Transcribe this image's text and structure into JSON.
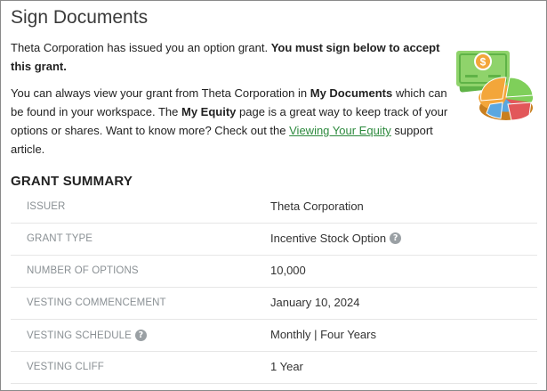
{
  "page": {
    "title": "Sign Documents"
  },
  "intro": {
    "p1_text": "Theta Corporation has issued you an option grant. ",
    "p1_bold": "You must sign below to accept this grant.",
    "p2_a": "You can always view your grant from Theta Corporation in ",
    "p2_b_bold": "My Documents",
    "p2_c": " which can be found in your workspace. The ",
    "p2_d_bold": "My Equity",
    "p2_e": " page is a great way to keep track of your options or shares. Want to know more? Check out the ",
    "p2_link": "Viewing Your Equity",
    "p2_f": " support article."
  },
  "illustration": {
    "icon": "money-and-pie-chart-icon",
    "currency_symbol": "$",
    "colors": {
      "bill": "#8fd36b",
      "bill_dark": "#5fb347",
      "pie_orange": "#f3a63a",
      "pie_blue": "#5aa7e0",
      "pie_green": "#7fcf5a",
      "pie_red": "#e2575a"
    }
  },
  "grant_summary": {
    "heading": "GRANT SUMMARY",
    "help_glyph": "?",
    "rows": [
      {
        "label": "ISSUER",
        "value": "Theta Corporation",
        "label_help": false,
        "value_help": false
      },
      {
        "label": "GRANT TYPE",
        "value": "Incentive Stock Option",
        "label_help": false,
        "value_help": true
      },
      {
        "label": "NUMBER OF OPTIONS",
        "value": "10,000",
        "label_help": false,
        "value_help": false
      },
      {
        "label": "VESTING COMMENCEMENT",
        "value": "January 10, 2024",
        "label_help": false,
        "value_help": false
      },
      {
        "label": "VESTING SCHEDULE",
        "value": "Monthly | Four Years",
        "label_help": true,
        "value_help": false
      },
      {
        "label": "VESTING CLIFF",
        "value": "1 Year",
        "label_help": false,
        "value_help": false
      }
    ]
  }
}
